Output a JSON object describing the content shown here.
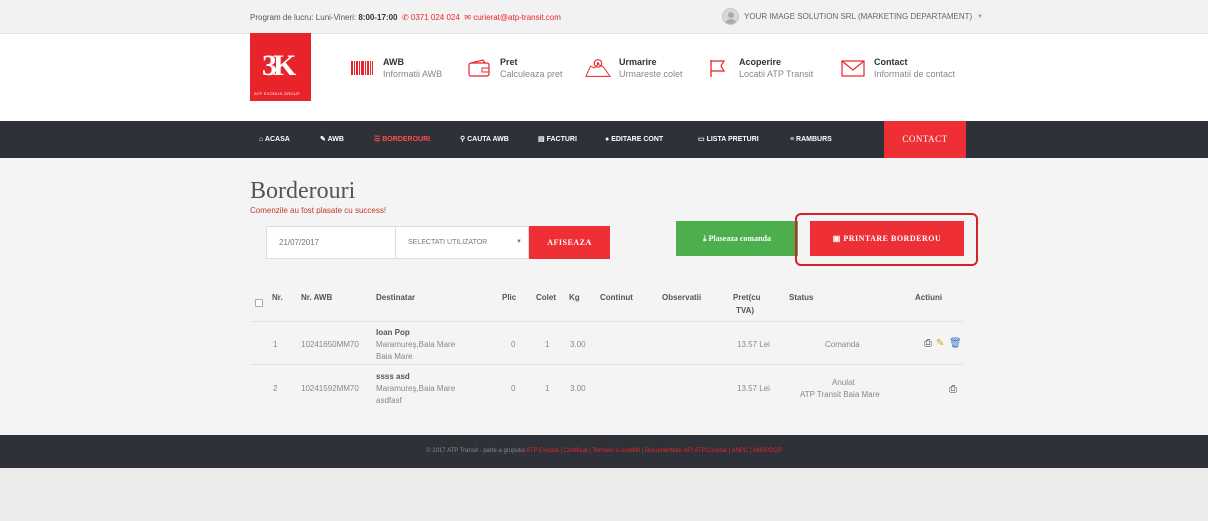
{
  "topbar": {
    "program_label": "Program de lucru: Luni-Vineri:",
    "program_hours": "8:00-17:00",
    "phone": "0371 024 024",
    "email": "curierat@atp-transit.com",
    "user": "YOUR IMAGE SOLUTION SRL (MARKETING DEPARTAMENT)",
    "user_arrow": "▼"
  },
  "logo": {
    "mark": "3K",
    "tag": "ATP EXODUS GROUP"
  },
  "header_items": [
    {
      "title": "AWB",
      "subtitle": "Informatii AWB",
      "icon": "barcode-icon"
    },
    {
      "title": "Pret",
      "subtitle": "Calculeaza pret",
      "icon": "wallet-icon"
    },
    {
      "title": "Urmarire",
      "subtitle": "Urmareste colet",
      "icon": "map-pin-icon"
    },
    {
      "title": "Acoperire",
      "subtitle": "Locatii ATP Transit",
      "icon": "flag-icon"
    },
    {
      "title": "Contact",
      "subtitle": "Informatii de contact",
      "icon": "envelope-icon"
    }
  ],
  "nav": {
    "items": [
      {
        "label": "ACASA",
        "icon": "home-icon"
      },
      {
        "label": "AWB",
        "icon": "pencil-icon"
      },
      {
        "label": "BORDEROURI",
        "icon": "list-icon"
      },
      {
        "label": "CAUTA AWB",
        "icon": "search-icon"
      },
      {
        "label": "FACTURI",
        "icon": "invoice-icon"
      },
      {
        "label": "EDITARE CONT",
        "icon": "user-icon"
      },
      {
        "label": "LISTA PRETURI",
        "icon": "folder-icon"
      },
      {
        "label": "RAMBURS",
        "icon": "menu-icon"
      }
    ],
    "contact": "CONTACT"
  },
  "main": {
    "title": "Borderouri",
    "success": "Comenzile au fost plasate cu success!",
    "date_value": "21/07/2017",
    "select_value": "SELECTATI UTILIZATOR",
    "btn_afiseaza": "AFISEAZA",
    "btn_plaseaza": "Plaseaza comanda",
    "btn_printare": "PRINTARE BORDEROU"
  },
  "table": {
    "headers": [
      "Nr.",
      "Nr. AWB",
      "Destinatar",
      "Plic",
      "Colet",
      "Kg",
      "Continut",
      "Observatii",
      "Pret(cu",
      "TVA)",
      "Status",
      "Actiuni"
    ],
    "rows": [
      {
        "nr": "1",
        "awb": "10241650MM70",
        "name": "Ioan Pop",
        "addr1": "Maramureş,Baia Mare",
        "addr2": "Baia Mare",
        "plic": "0",
        "colet": "1",
        "kg": "3.00",
        "pret": "13.57 Lei",
        "status1": "Comanda",
        "status2": ""
      },
      {
        "nr": "2",
        "awb": "10241592MM70",
        "name": "ssss asd",
        "addr1": "Maramureş,Baia Mare",
        "addr2": "asdfasf",
        "plic": "0",
        "colet": "1",
        "kg": "3.00",
        "pret": "13.57 Lei",
        "status1": "Anulat",
        "status2": "ATP Transit Baia Mare"
      }
    ]
  },
  "footer": {
    "text": "© 2017 ATP Transit - parte a grupului",
    "links": "ATP Exodus | Certificat | Termeni si conditii | Documentatie API ATPCurierat | ANPC | ANSPDCP"
  },
  "colors": {
    "brand_red": "#ee2f36",
    "nav_dark": "#2e3238",
    "green": "#4cae4c"
  }
}
